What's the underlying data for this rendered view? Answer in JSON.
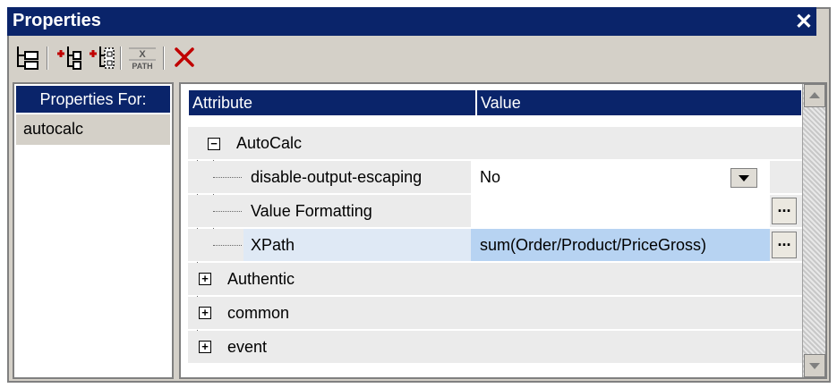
{
  "window": {
    "title": "Properties",
    "close_glyph": "✕"
  },
  "toolbar": {
    "buttons": [
      {
        "name": "tree-view-icon"
      },
      {
        "name": "add-node-icon"
      },
      {
        "name": "add-child-node-icon"
      },
      {
        "name": "xpath-icon",
        "top": "X",
        "bottom": "PATH"
      },
      {
        "name": "delete-icon"
      }
    ]
  },
  "left_pane": {
    "header": "Properties For:",
    "selected_item": "autocalc"
  },
  "grid": {
    "columns": [
      "Attribute",
      "Value"
    ],
    "autocalc_group": "AutoCalc",
    "rows": [
      {
        "attribute": "disable-output-escaping",
        "value": "No"
      },
      {
        "attribute": "Value Formatting",
        "value": ""
      },
      {
        "attribute": "XPath",
        "value": "sum(Order/Product/PriceGross)"
      }
    ],
    "groups": [
      "Authentic",
      "common",
      "event"
    ],
    "dots_label": "..."
  },
  "colors": {
    "title_bar": "#0a246a",
    "selection": "#b7d3f2",
    "panel": "#d4d0c8"
  }
}
